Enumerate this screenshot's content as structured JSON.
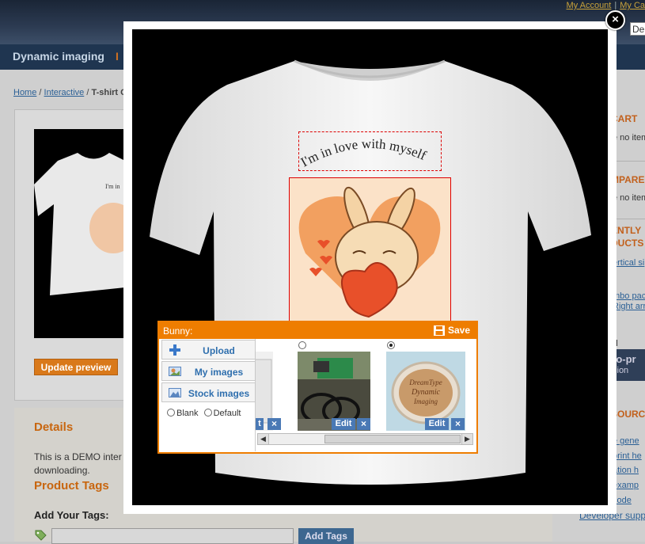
{
  "header": {
    "my_account": "My Account",
    "separator": "|",
    "my_cart": "My Ca",
    "language": "De"
  },
  "nav": {
    "item1": "Dynamic imaging",
    "item2": "I"
  },
  "breadcrumb": {
    "home": "Home",
    "sep": "/",
    "interactive": "Interactive",
    "current": "T-shirt C"
  },
  "product": {
    "update_preview": "Update preview"
  },
  "details": {
    "title": "Details",
    "text_line1": "This is a DEMO inter",
    "text_line2": "downloading.",
    "tags_title": "Product Tags",
    "add_tags_label": "Add Your Tags:",
    "add_tags_button": "Add Tags"
  },
  "sidebar": {
    "cart_head": "CART",
    "cart_text": "e no item",
    "compare_head": "MPARE",
    "compare_text": "e no item",
    "recent_head1": "ENTLY",
    "recent_head2": "DUCTS",
    "link1": "ertical si",
    "link2": "",
    "link3": "mbo pac",
    "link4": "Right arr",
    "label_d": "d",
    "promo1": "to-pr",
    "promo2": "sion",
    "resources_head": "SOURC",
    "res1": "e gene",
    "res2": "print he",
    "res3": "ation h",
    "res4": "examp",
    "res5": "code",
    "dev_support": "Developer supp"
  },
  "modal": {
    "close": "×",
    "design_text": "I'm in love with myself"
  },
  "editor": {
    "title": "Bunny:",
    "save": "Save",
    "tabs": [
      {
        "label": "Upload",
        "icon": "plus-icon"
      },
      {
        "label": "My images",
        "icon": "my-images-icon"
      },
      {
        "label": "Stock images",
        "icon": "stock-images-icon"
      }
    ],
    "radio_blank": "Blank",
    "radio_default": "Default",
    "thumbnails": [
      {
        "edit": "t",
        "delete": "×",
        "selected": false
      },
      {
        "edit": "Edit",
        "delete": "×",
        "selected": false
      },
      {
        "edit": "Edit",
        "delete": "×",
        "selected": true
      }
    ],
    "thumb3_text1": "DreamType",
    "thumb3_text2": "Dynamic",
    "thumb3_text3": "Imaging"
  },
  "colors": {
    "accent_orange": "#ee7d00",
    "link_blue": "#2a5f95",
    "button_blue": "#4a79b5"
  }
}
